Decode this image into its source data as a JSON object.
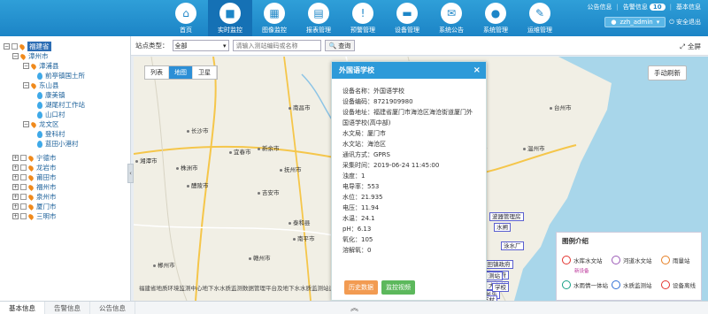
{
  "header": {
    "alarm_info": "公告信息",
    "warning_info": "告警信息",
    "warning_count": "10",
    "basic_info": "基本信息",
    "user": "zzh_admin",
    "logout": "安全退出"
  },
  "nav": {
    "items": [
      {
        "label": "首页",
        "icon": "home-icon",
        "glyph": "⌂"
      },
      {
        "label": "实时监控",
        "icon": "camera-icon",
        "glyph": "■"
      },
      {
        "label": "图像监控",
        "icon": "image-icon",
        "glyph": "▦"
      },
      {
        "label": "报表管理",
        "icon": "report-icon",
        "glyph": "▤"
      },
      {
        "label": "预警管理",
        "icon": "warning-icon",
        "glyph": "!"
      },
      {
        "label": "设备管理",
        "icon": "device-icon",
        "glyph": "▬"
      },
      {
        "label": "系统公告",
        "icon": "announcement-icon",
        "glyph": "✉"
      },
      {
        "label": "系统管理",
        "icon": "user-admin-icon",
        "glyph": "●"
      },
      {
        "label": "运维管理",
        "icon": "maintenance-icon",
        "glyph": "✎"
      }
    ]
  },
  "tree": {
    "root": "福建省",
    "nodes": [
      {
        "label": "漳州市",
        "type": "city"
      },
      {
        "label": "漳浦县",
        "type": "county"
      },
      {
        "label": "前亭镇国土所",
        "type": "station"
      },
      {
        "label": "东山县",
        "type": "county"
      },
      {
        "label": "康美镇",
        "type": "station"
      },
      {
        "label": "湖尾村工作站",
        "type": "station"
      },
      {
        "label": "山口村",
        "type": "station"
      },
      {
        "label": "龙文区",
        "type": "county"
      },
      {
        "label": "登科村",
        "type": "station"
      },
      {
        "label": "蓝田小港村",
        "type": "station"
      },
      {
        "label": "宁德市",
        "type": "city2"
      },
      {
        "label": "龙岩市",
        "type": "city2"
      },
      {
        "label": "莆田市",
        "type": "city2"
      },
      {
        "label": "福州市",
        "type": "city2"
      },
      {
        "label": "泉州市",
        "type": "city2"
      },
      {
        "label": "厦门市",
        "type": "city2"
      },
      {
        "label": "三明市",
        "type": "city2"
      }
    ]
  },
  "filter": {
    "type_label": "站点类型：",
    "type_value": "全部",
    "search_placeholder": "请输入测站编码或名称",
    "query_label": "查询",
    "fullscreen_label": "全屏"
  },
  "map": {
    "map_types": [
      "列表",
      "地图",
      "卫星"
    ],
    "active_type": "地图",
    "refresh": "手动刷新",
    "cities": [
      "南昌市",
      "长沙市",
      "湘潭市",
      "株洲市",
      "醴陵市",
      "宜春市",
      "新余市",
      "吉安市",
      "泰和县",
      "抚州市",
      "丽水市",
      "台州市",
      "温州市",
      "郴州市",
      "赣州市",
      "南平市",
      "宁德市",
      "福州市"
    ],
    "station_tags": [
      "波器管理房",
      "水闸",
      "泳水厂",
      "江田镇政府",
      "江镇政府",
      "测站",
      "大士所",
      "长乐",
      "下村",
      "学校"
    ],
    "footer": "福建省地质环境监测中心地下水水质监测数据管理平台及地下水水质监测站运维管理平台 © 2018"
  },
  "popup": {
    "title": "外国语学校",
    "fields": [
      "设备名称：外国语学校",
      "设备编码：8721909980",
      "设备地址：福建省厦门市海沧区海沧街道厦门外国语学校(高中部)",
      "水文局：厦门市",
      "水文站：海沧区",
      "通讯方式：GPRS",
      "采集时间：2019-06-24 11:45:00",
      "浊度：1",
      "电导率：553",
      "水位：21.935",
      "电压：11.94",
      "水温：24.1",
      "pH：6.13",
      "氧化：105",
      "溶解氧：0"
    ],
    "btn_history": "历史数据",
    "btn_video": "监控视频"
  },
  "legend": {
    "title": "图例介绍",
    "items": [
      "水库水文站",
      "河道水文站",
      "雨量站",
      "水雨情一体站",
      "水质监测站",
      "设备离线"
    ],
    "sub": "新设备"
  },
  "bottom_tabs": [
    "基本信息",
    "告警信息",
    "公告信息"
  ],
  "colors": {
    "header": "#1f8bcc",
    "accent": "#2d9ad9",
    "history_btn": "#f29b52",
    "video_btn": "#5cb85c"
  }
}
